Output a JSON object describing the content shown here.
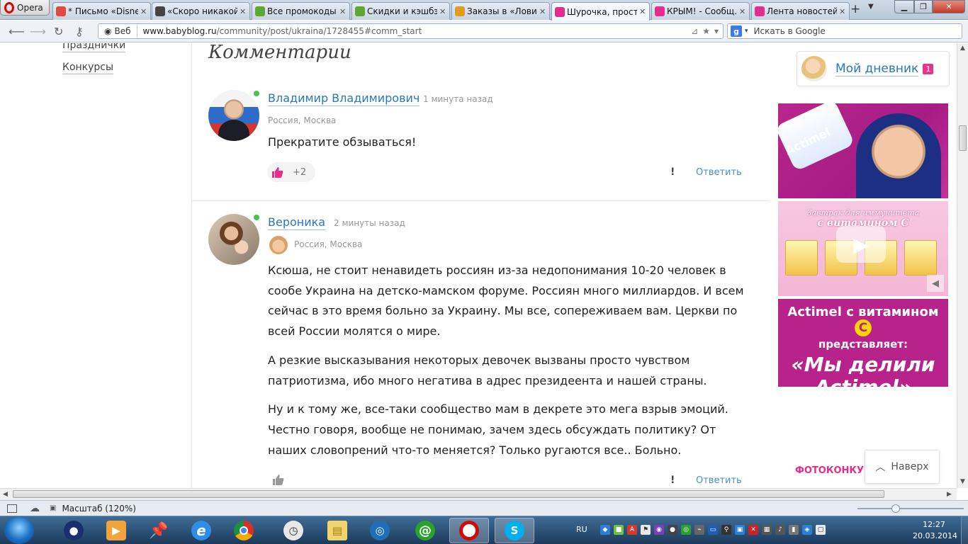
{
  "browser": {
    "app_name": "Opera",
    "tabs": [
      {
        "title": "* Письмо «Disne...",
        "icon": "mail-icon",
        "color": "#e34a3c"
      },
      {
        "title": "«Скоро никакой...",
        "icon": "km-icon",
        "color": "#444444"
      },
      {
        "title": "Все промокоды ...",
        "icon": "leaf-icon",
        "color": "#5ea832"
      },
      {
        "title": "Скидки и кэшбэ...",
        "icon": "leaf-icon",
        "color": "#5ea832"
      },
      {
        "title": "Заказы в «Лови...",
        "icon": "box-icon",
        "color": "#e39b1f"
      },
      {
        "title": "Шурочка, прост...",
        "icon": "babyblog-icon",
        "color": "#e62c8c"
      },
      {
        "title": "КРЫМ! - Сообщ...",
        "icon": "babyblog-icon",
        "color": "#e62c8c"
      },
      {
        "title": "Лента новостей ...",
        "icon": "babyblog-icon",
        "color": "#e62c8c"
      }
    ],
    "active_tab": 5,
    "web_label": "Веб",
    "url_host": "www.babyblog.ru",
    "url_path": "/community/post/ukraina/1728455#comm_start",
    "search_placeholder": "Искать в Google"
  },
  "sidebar_nav": {
    "items": [
      "Празднички",
      "Конкурсы"
    ]
  },
  "comments": {
    "heading": "Комментарии",
    "items": [
      {
        "author": "Владимир Владимирович",
        "time": "1 минута назад",
        "location": "Россия, Москва",
        "text": [
          "Прекратите обзываться!"
        ],
        "likes": "+2",
        "flag": "!",
        "reply": "Ответить"
      },
      {
        "author": "Вероника",
        "time": "2 минуты назад",
        "location": "Россия, Москва",
        "text": [
          "Ксюша, не стоит ненавидеть россиян из-за недопонимания 10-20 человек в сообе Украина на детско-мамском форуме. Россиян много миллиардов. И всем сейчас в это время больно за Украину. Мы все, сопереживаем вам. Церкви по всей России молятся о мире.",
          "А резкие высказывания некоторых девочек вызваны просто чувством патриотизма, ибо много негатива в адрес президеента и нашей страны.",
          "Ну и к тому же, все-таки сообщество мам в декрете это мега взрыв эмоций. Честно говоря, вообще не понимаю, зачем здесь обсуждать политику? От наших словопрений что-то меняется? Только ругаются все.. Больно."
        ],
        "flag": "!",
        "reply": "Ответить"
      }
    ]
  },
  "right_column": {
    "diary_label": "Мой дневник",
    "diary_count": "1",
    "ad_brand": "Actimel",
    "ad2_heading_a": "Завтрак для иммунитета",
    "ad2_heading_b": "с витамином С",
    "ad3_line1": "Actimel с витамином",
    "ad3_vitamin": "С",
    "ad3_line2": "представляет:",
    "ad3_line3": "«Мы делили Actimel»",
    "photo_contest": "ФОТОКОНКУРС",
    "back_to_top": "Наверх"
  },
  "statusbar": {
    "zoom": "Масштаб (120%)"
  },
  "taskbar": {
    "language": "RU",
    "time": "12:27",
    "date": "20.03.2014"
  },
  "colors": {
    "link": "#2a77b9",
    "accent": "#e62c8c",
    "ad_magenta": "#b7238a",
    "online": "#47c447"
  }
}
